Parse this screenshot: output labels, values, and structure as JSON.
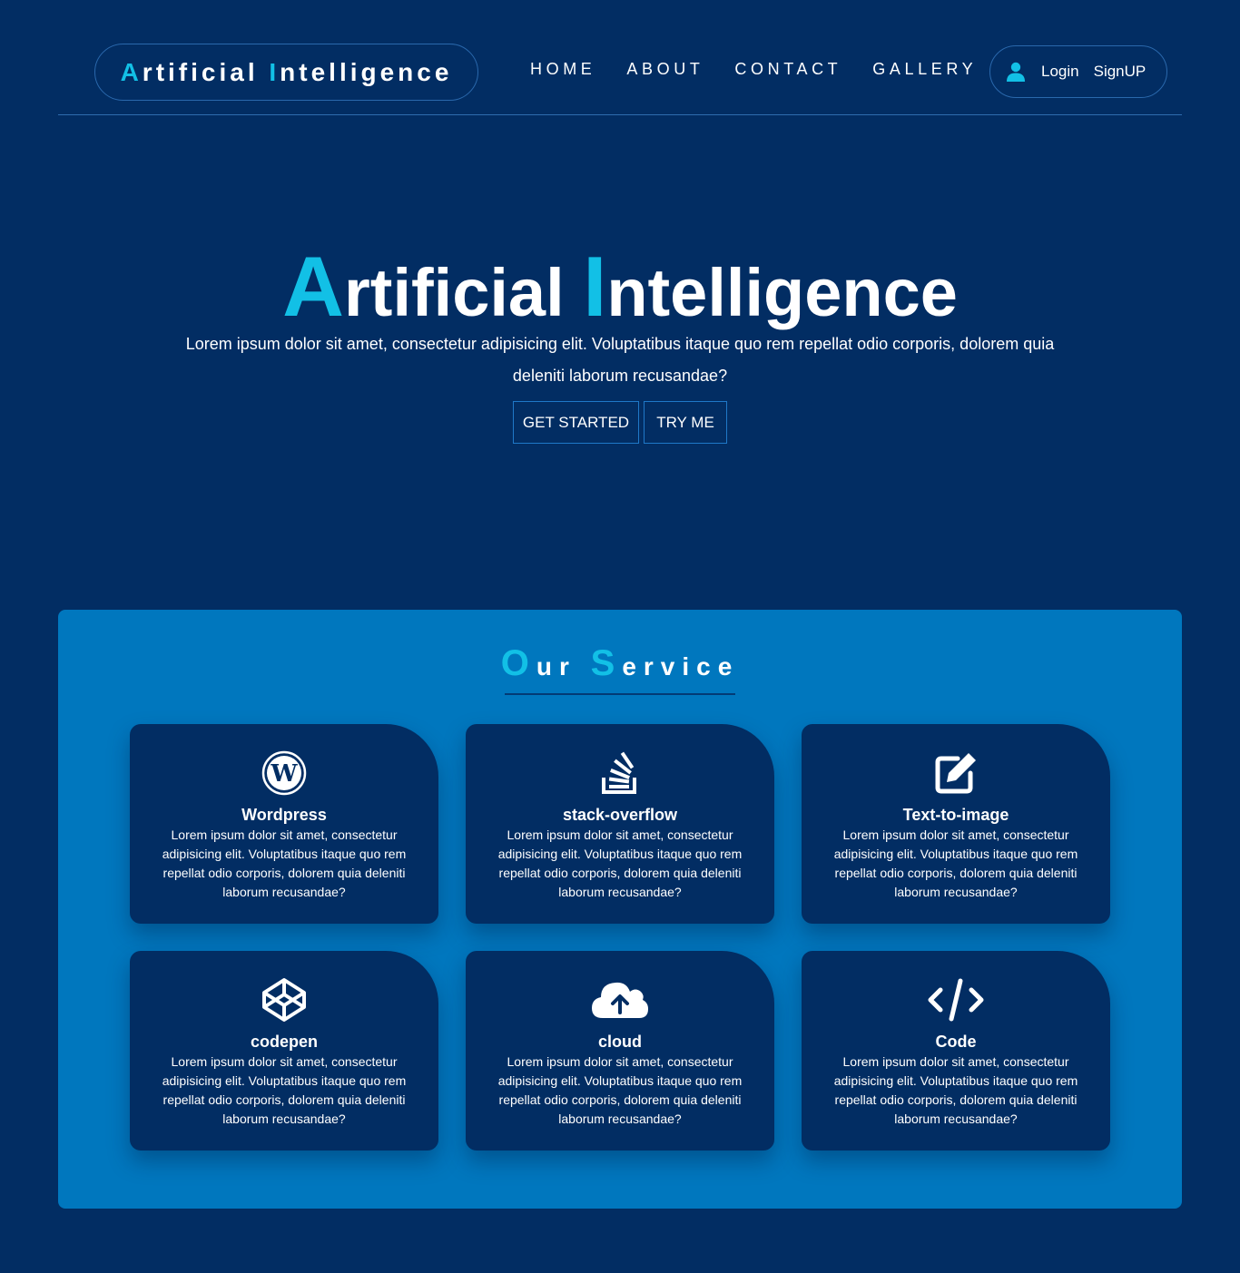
{
  "brand": {
    "first_letter": "A",
    "first_rest": "rtificial",
    "second_letter": "I",
    "second_rest": "ntelligence"
  },
  "nav": {
    "items": [
      {
        "label": "HOME"
      },
      {
        "label": "ABOUT"
      },
      {
        "label": "CONTACT"
      },
      {
        "label": "GALLERY"
      }
    ],
    "auth": {
      "icon": "user-icon",
      "login_label": "Login",
      "signup_label": "SignUP"
    }
  },
  "hero": {
    "title": {
      "first_letter": "A",
      "first_rest": "rtificial",
      "second_letter": "I",
      "second_rest": "ntelligence"
    },
    "text": "Lorem ipsum dolor sit amet, consectetur adipisicing elit. Voluptatibus itaque quo rem repellat odio corporis, dolorem quia deleniti laborum recusandae?",
    "buttons": {
      "start_label": "GET STARTED",
      "try_label": "TRY ME"
    }
  },
  "services": {
    "heading": {
      "first_letter": "O",
      "first_rest": "ur",
      "second_letter": "S",
      "second_rest": "ervice"
    },
    "cards": [
      {
        "title": "Wordpress",
        "icon": "wordpress-icon",
        "text": "Lorem ipsum dolor sit amet, consectetur adipisicing elit. Voluptatibus itaque quo rem repellat odio corporis, dolorem quia deleniti laborum recusandae?"
      },
      {
        "title": "stack-overflow",
        "icon": "stack-overflow-icon",
        "text": "Lorem ipsum dolor sit amet, consectetur adipisicing elit. Voluptatibus itaque quo rem repellat odio corporis, dolorem quia deleniti laborum recusandae?"
      },
      {
        "title": "Text-to-image",
        "icon": "edit-icon",
        "text": "Lorem ipsum dolor sit amet, consectetur adipisicing elit. Voluptatibus itaque quo rem repellat odio corporis, dolorem quia deleniti laborum recusandae?"
      },
      {
        "title": "codepen",
        "icon": "codepen-icon",
        "text": "Lorem ipsum dolor sit amet, consectetur adipisicing elit. Voluptatibus itaque quo rem repellat odio corporis, dolorem quia deleniti laborum recusandae?"
      },
      {
        "title": "cloud",
        "icon": "cloud-upload-icon",
        "text": "Lorem ipsum dolor sit amet, consectetur adipisicing elit. Voluptatibus itaque quo rem repellat odio corporis, dolorem quia deleniti laborum recusandae?"
      },
      {
        "title": "Code",
        "icon": "code-icon",
        "text": "Lorem ipsum dolor sit amet, consectetur adipisicing elit. Voluptatibus itaque quo rem repellat odio corporis, dolorem quia deleniti laborum recusandae?"
      }
    ]
  },
  "colors": {
    "page_background": "#022d63",
    "accent": "#12c0e6",
    "services_panel": "#0077be",
    "card_background": "#022d63"
  }
}
